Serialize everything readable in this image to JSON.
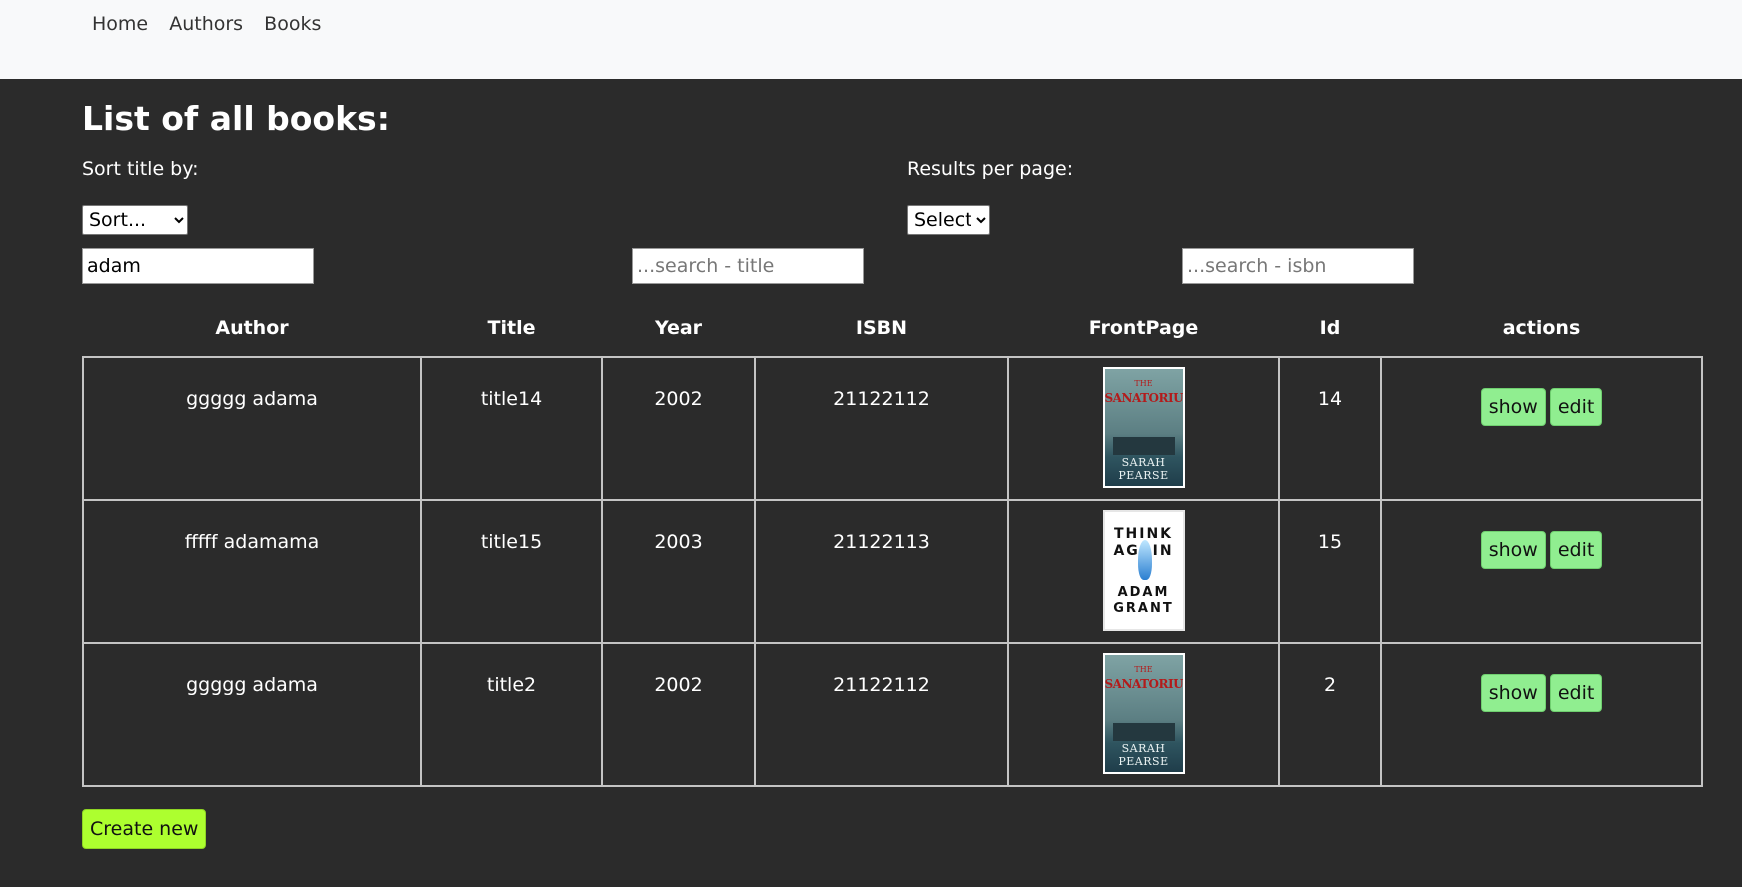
{
  "nav": {
    "items": [
      "Home",
      "Authors",
      "Books"
    ]
  },
  "page": {
    "title": "List of all books:"
  },
  "controls": {
    "sort_label": "Sort title by:",
    "sort_selected": "Sort...",
    "results_label": "Results per page:",
    "results_selected": "Select",
    "author_search_value": "adam",
    "title_search_placeholder": "...search - title",
    "isbn_search_placeholder": "...search - isbn"
  },
  "table": {
    "headers": [
      "Author",
      "Title",
      "Year",
      "ISBN",
      "FrontPage",
      "Id",
      "actions"
    ],
    "rows": [
      {
        "author": "ggggg adama",
        "title": "title14",
        "year": "2002",
        "isbn": "21122112",
        "cover": "sanatorium-cover",
        "id": "14"
      },
      {
        "author": "fffff adamama",
        "title": "title15",
        "year": "2003",
        "isbn": "21122113",
        "cover": "think-again-cover",
        "id": "15"
      },
      {
        "author": "ggggg adama",
        "title": "title2",
        "year": "2002",
        "isbn": "21122112",
        "cover": "sanatorium-cover",
        "id": "2"
      }
    ],
    "show_label": "show",
    "edit_label": "edit"
  },
  "covers": {
    "sanatorium": {
      "line1": "THE",
      "line2": "SANATORIUM",
      "line3": "SARAH PEARSE"
    },
    "think_again": {
      "line1": "THINK",
      "line2": "AGAIN",
      "line3": "ADAM",
      "line4": "GRANT"
    }
  },
  "create_label": "Create new",
  "colors": {
    "page_bg": "#2b2b2b",
    "navbar_bg": "#f8f9fa",
    "action_button": "#90ee90",
    "create_button": "#adff2f"
  }
}
